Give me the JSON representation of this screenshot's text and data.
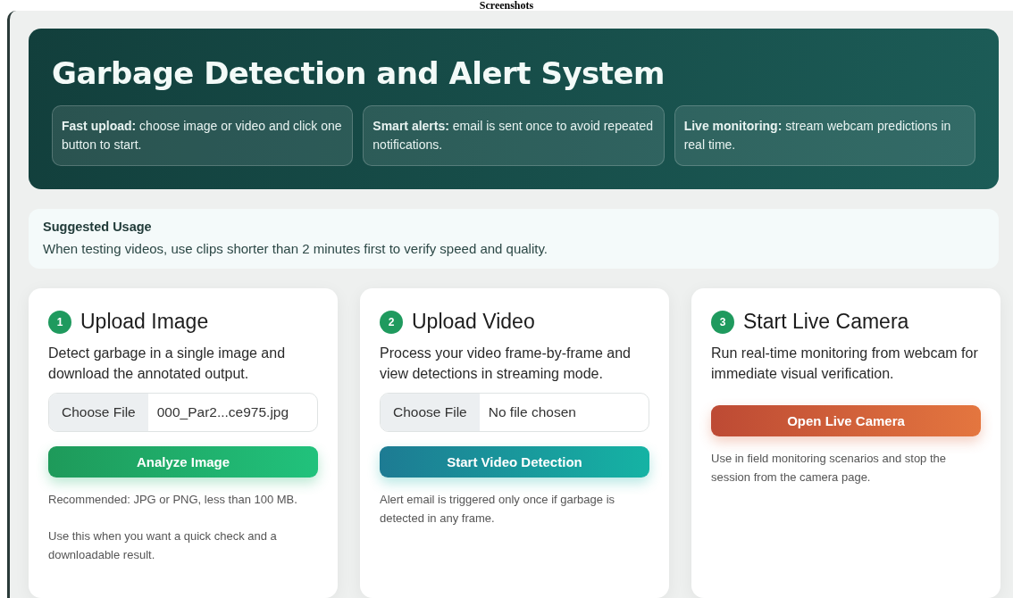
{
  "caption": "Screenshots",
  "hero": {
    "title": "Garbage Detection and Alert System",
    "features": [
      {
        "text": "**Fast upload:** choose image or video and click one button to start."
      },
      {
        "text": "**Smart alerts:** email is sent once to avoid repeated notifications."
      },
      {
        "text": "**Live monitoring:** stream webcam predictions in real time."
      }
    ]
  },
  "usage": {
    "title": "Suggested Usage",
    "text": "When testing videos, use clips shorter than 2 minutes first to verify speed and quality."
  },
  "cards": [
    {
      "kind": "image",
      "number": "1",
      "title": "Upload Image",
      "description": "Detect garbage in a single image and download the annotated output.",
      "file": {
        "button": "Choose File",
        "value": "000_Par2...ce975.jpg"
      },
      "action": "Analyze Image",
      "notes": [
        "Recommended: JPG or PNG, less than 100 MB.",
        "Use this when you want a quick check and a downloadable result."
      ]
    },
    {
      "kind": "video",
      "number": "2",
      "title": "Upload Video",
      "description": "Process your video frame-by-frame and view detections in streaming mode.",
      "file": {
        "button": "Choose File",
        "value": "No file chosen"
      },
      "action": "Start Video Detection",
      "notes": [
        "Alert email is triggered only once if garbage is detected in any frame."
      ]
    },
    {
      "kind": "camera",
      "number": "3",
      "title": "Start Live Camera",
      "description": "Run real-time monitoring from webcam for immediate visual verification.",
      "action": "Open Live Camera",
      "notes": [
        "Use in field monitoring scenarios and stop the session from the camera page."
      ]
    }
  ]
}
